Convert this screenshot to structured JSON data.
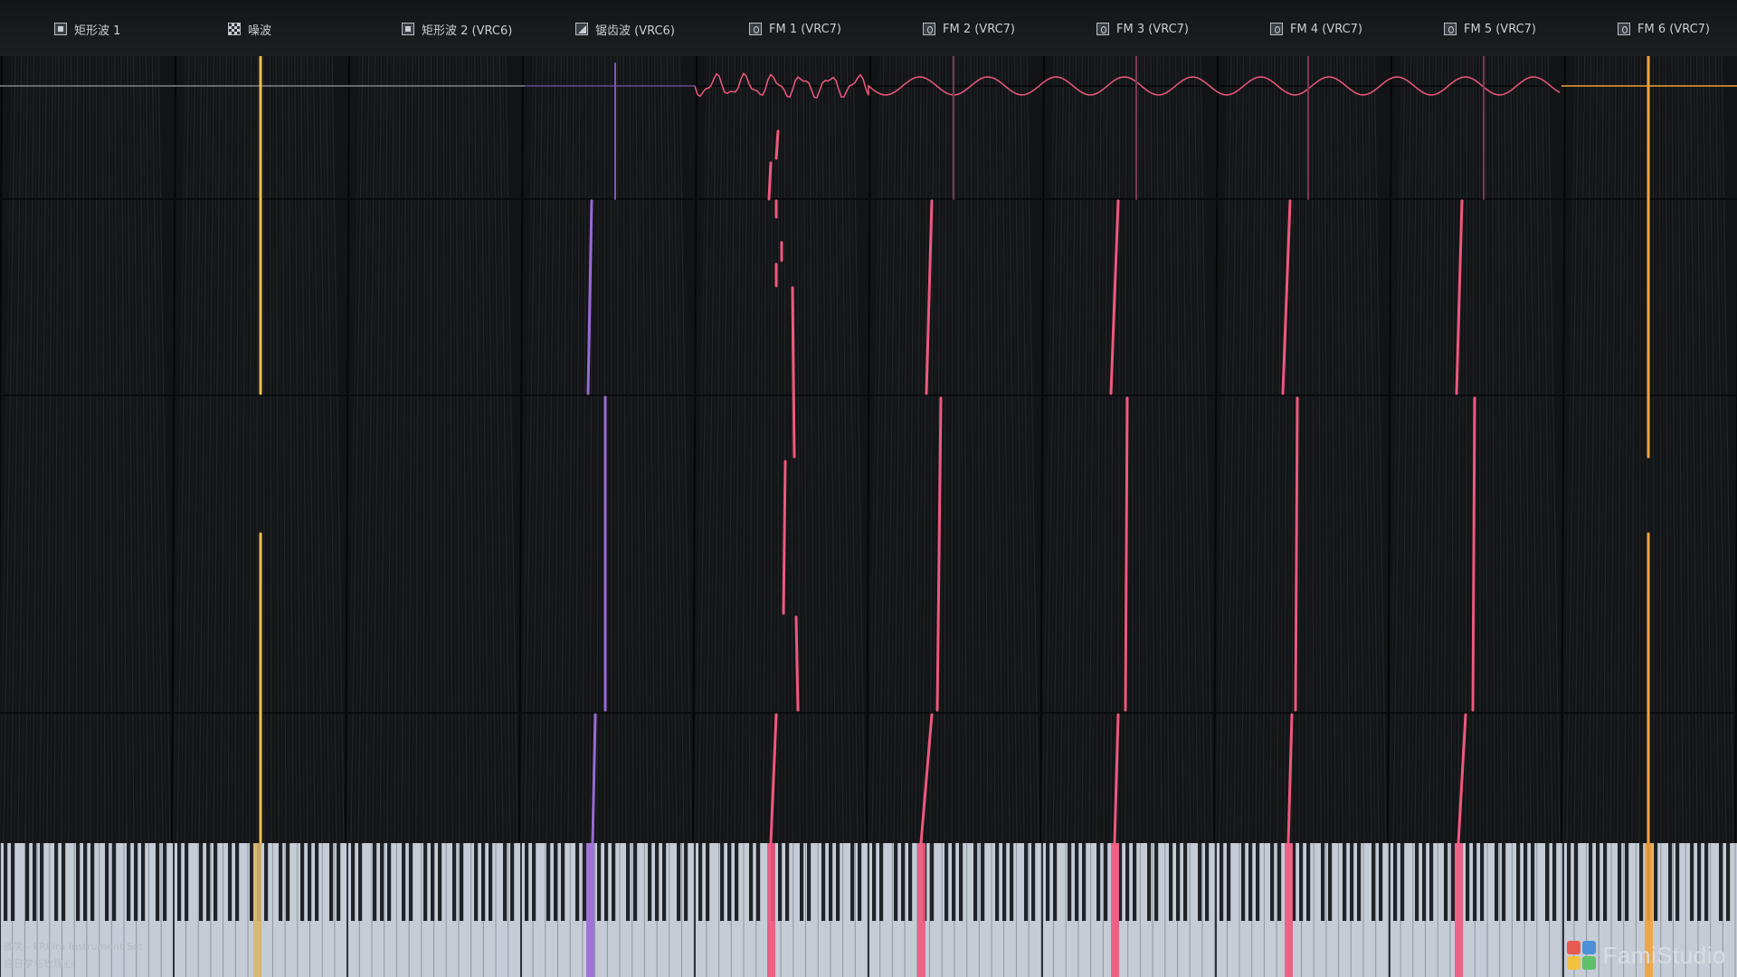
{
  "channels": [
    {
      "label": "矩形波 1",
      "icon": "square-wave-icon",
      "color": "#f4c04a"
    },
    {
      "label": "噪波",
      "icon": "noise-icon",
      "color": "#f4c04a"
    },
    {
      "label": "矩形波 2 (VRC6)",
      "icon": "square-wave-icon",
      "color": "#9a6ad6"
    },
    {
      "label": "锯齿波 (VRC6)",
      "icon": "sawtooth-icon",
      "color": "#9a6ad6"
    },
    {
      "label": "FM 1 (VRC7)",
      "icon": "fm-icon",
      "color": "#f0587e"
    },
    {
      "label": "FM 2 (VRC7)",
      "icon": "fm-icon",
      "color": "#f0587e"
    },
    {
      "label": "FM 3 (VRC7)",
      "icon": "fm-icon",
      "color": "#f0587e"
    },
    {
      "label": "FM 4 (VRC7)",
      "icon": "fm-icon",
      "color": "#f0587e"
    },
    {
      "label": "FM 5 (VRC7)",
      "icon": "fm-icon",
      "color": "#f0587e"
    },
    {
      "label": "FM 6 (VRC7)",
      "icon": "fm-icon",
      "color": "#f2a33a"
    }
  ],
  "credits": {
    "line1": "微笑 - FREira Instrument Set",
    "line2": "自日梦与玫瑰心"
  },
  "logo": {
    "text": "FamiStudio"
  },
  "colors": {
    "background": "#121416",
    "grid_dark": "#1a1d20",
    "grid_light": "#2a2e33",
    "pink": "#f0587e",
    "purple": "#9a6ad6",
    "yellow": "#f4c04a",
    "orange": "#f2a33a",
    "keys_white": "#c5ccd6",
    "keys_black": "#202327"
  }
}
